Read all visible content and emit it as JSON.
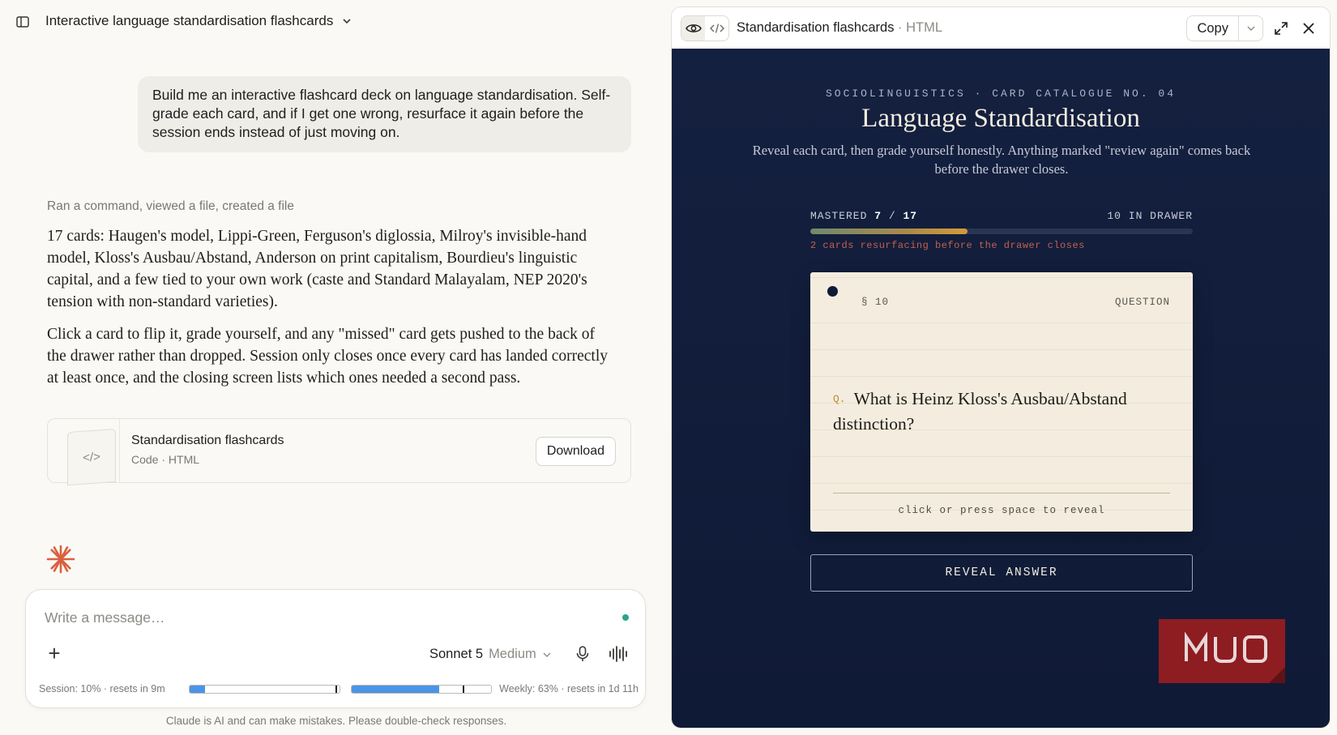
{
  "header": {
    "chat_title": "Interactive language standardisation flashcards"
  },
  "user_message": "Build me an interactive flashcard deck on language standardisation. Self-grade each card, and if I get one wrong, resurface it again before the session ends instead of just moving on.",
  "assistant": {
    "tools_summary": "Ran a command, viewed a file, created a file",
    "paragraphs": [
      "17 cards: Haugen's model, Lippi-Green, Ferguson's diglossia, Milroy's invisible-hand model, Kloss's Ausbau/Abstand, Anderson on print capitalism, Bourdieu's linguistic capital, and a few tied to your own work (caste and Standard Malayalam, NEP 2020's tension with non-standard varieties).",
      "Click a card to flip it, grade yourself, and any \"missed\" card gets pushed to the back of the drawer rather than dropped. Session only closes once every card has landed correctly at least once, and the closing screen lists which ones needed a second pass."
    ],
    "artifact": {
      "icon_text": "</>",
      "name": "Standardisation flashcards",
      "meta": "Code · HTML",
      "download_label": "Download"
    }
  },
  "composer": {
    "placeholder": "Write a message…",
    "model": "Sonnet 5",
    "effort": "Medium",
    "session_usage": "Session: 10% · resets in 9m",
    "session_fraction": 0.1,
    "weekly_usage": "Weekly: 63% · resets in 1d 11h",
    "weekly_fraction": 0.63,
    "status_color": "#2aa58a"
  },
  "disclaimer": "Claude is AI and can make mistakes. Please double-check responses.",
  "artifact_pane": {
    "title": "Standardisation flashcards",
    "title_suffix": "· HTML",
    "copy_label": "Copy",
    "icons": [
      "eye-icon",
      "code-icon",
      "chevron-down-icon",
      "expand-icon",
      "close-icon"
    ]
  },
  "preview": {
    "kicker": "SOCIOLINGUISTICS · CARD CATALOGUE NO. 04",
    "title": "Language Standardisation",
    "subtitle": "Reveal each card, then grade yourself honestly. Anything marked \"review again\" comes back before the drawer closes.",
    "mastered_label": "MASTERED",
    "mastered": "7",
    "total": "17",
    "mastered_fraction": 0.412,
    "drawer_count": "10 IN DRAWER",
    "resurfacing_note": "2 cards resurfacing before the drawer closes",
    "card": {
      "number": "§ 10",
      "kind": "QUESTION",
      "q_marker": "Q.",
      "question": "What is Heinz Kloss's Ausbau/Abstand distinction?",
      "hint": "click or press space to reveal"
    },
    "reveal_label": "REVEAL ANSWER",
    "background_color": "#14203f",
    "accent_color": "#c2604b",
    "watermark": "MUO"
  }
}
